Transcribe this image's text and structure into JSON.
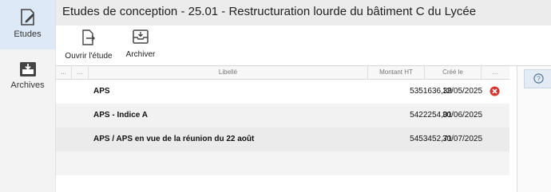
{
  "nav": {
    "items": [
      {
        "label": "Etudes",
        "icon": "document-edit-icon",
        "active": true
      },
      {
        "label": "Archives",
        "icon": "archive-box-icon",
        "active": false
      }
    ]
  },
  "header": {
    "title": "Etudes de conception - 25.01 - Restructuration lourde du bâtiment C du Lycée"
  },
  "toolbar": {
    "open_label": "Ouvrir l'étude",
    "archive_label": "Archiver"
  },
  "table": {
    "columns": {
      "c1": "...",
      "c2": "...",
      "libelle": "Libellé",
      "montant": "Montant HT",
      "cree": "Créé le",
      "c6": "..."
    },
    "rows": [
      {
        "libelle": "APS",
        "montant": "5351636,39",
        "date": "12/05/2025",
        "deletable": true
      },
      {
        "libelle": "APS - Indice A",
        "montant": "5422254,01",
        "date": "30/06/2025",
        "deletable": false
      },
      {
        "libelle": "APS / APS en vue de la réunion du 22 août",
        "montant": "5453452,71",
        "date": "30/07/2025",
        "deletable": false
      }
    ]
  },
  "colors": {
    "accent": "#2f6fb6",
    "delete": "#d9342b",
    "nav_active": "#dde9f7"
  },
  "right_panel": {
    "icon": "help-icon"
  }
}
